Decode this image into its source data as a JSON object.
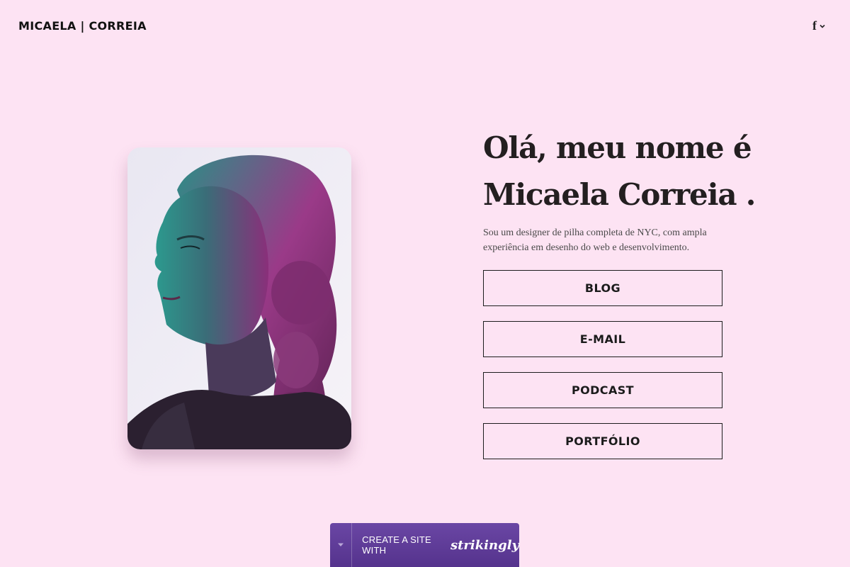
{
  "header": {
    "site_title": "MICAELA | CORREIA",
    "social_icon": "facebook-icon",
    "dropdown_icon": "chevron-down-icon"
  },
  "hero": {
    "heading_line1": "Olá, meu nome é",
    "heading_line2": "Micaela Correia .",
    "intro": "Sou um designer de pilha completa de NYC, com ampla experiência em desenho do web e desenvolvimento.",
    "photo_icon": "portrait-photo"
  },
  "links": [
    {
      "label": "BLOG"
    },
    {
      "label": "E-MAIL"
    },
    {
      "label": "PODCAST"
    },
    {
      "label": "PORTFÓLIO"
    }
  ],
  "promo": {
    "text": "CREATE A SITE WITH",
    "brand": "strikingly"
  },
  "colors": {
    "background": "#fde3f3",
    "promo": "#5c3895",
    "text": "#231f20"
  }
}
